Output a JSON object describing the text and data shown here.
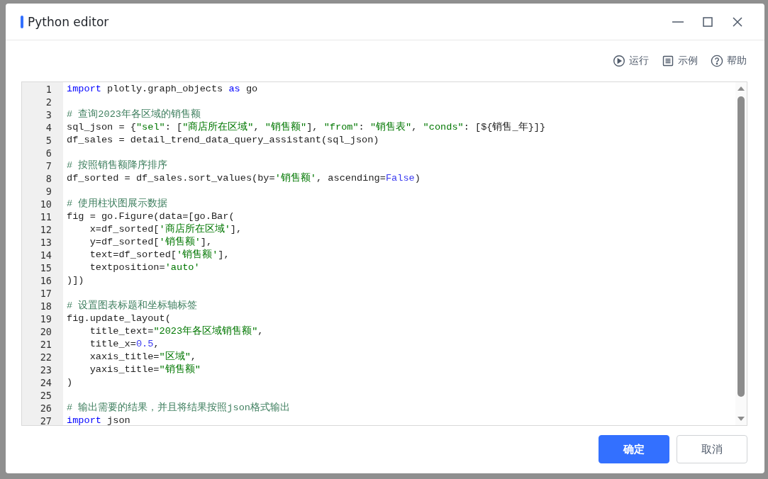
{
  "window": {
    "title": "Python editor"
  },
  "toolbar": [
    {
      "kind": "run",
      "label": "运行"
    },
    {
      "kind": "example",
      "label": "示例"
    },
    {
      "kind": "help",
      "label": "帮助"
    }
  ],
  "editor": {
    "lines": [
      {
        "number": "1",
        "tokens": [
          {
            "kind": "keyword",
            "text": "import"
          },
          {
            "kind": "plain",
            "text": " plotly.graph_objects "
          },
          {
            "kind": "keyword",
            "text": "as"
          },
          {
            "kind": "plain",
            "text": " go"
          }
        ]
      },
      {
        "number": "2"
      },
      {
        "number": "3",
        "tokens": [
          {
            "kind": "comment",
            "text": "# 查询2023年各区域的销售额"
          }
        ]
      },
      {
        "number": "4",
        "tokens": [
          {
            "kind": "plain",
            "text": "sql_json = {"
          },
          {
            "kind": "string",
            "text": "\"sel\""
          },
          {
            "kind": "plain",
            "text": ": ["
          },
          {
            "kind": "string",
            "text": "\"商店所在区域\""
          },
          {
            "kind": "plain",
            "text": ", "
          },
          {
            "kind": "string",
            "text": "\"销售额\""
          },
          {
            "kind": "plain",
            "text": "], "
          },
          {
            "kind": "string",
            "text": "\"from\""
          },
          {
            "kind": "plain",
            "text": ": "
          },
          {
            "kind": "string",
            "text": "\"销售表\""
          },
          {
            "kind": "plain",
            "text": ", "
          },
          {
            "kind": "string",
            "text": "\"conds\""
          },
          {
            "kind": "plain",
            "text": ": [${销售_年}]}"
          }
        ]
      },
      {
        "number": "5",
        "tokens": [
          {
            "kind": "plain",
            "text": "df_sales = detail_trend_data_query_assistant(sql_json)"
          }
        ]
      },
      {
        "number": "6"
      },
      {
        "number": "7",
        "tokens": [
          {
            "kind": "comment",
            "text": "# 按照销售额降序排序"
          }
        ]
      },
      {
        "number": "8",
        "tokens": [
          {
            "kind": "plain",
            "text": "df_sorted = df_sales.sort_values(by="
          },
          {
            "kind": "string",
            "text": "'销售额'"
          },
          {
            "kind": "plain",
            "text": ", ascending="
          },
          {
            "kind": "number",
            "text": "False"
          },
          {
            "kind": "plain",
            "text": ")"
          }
        ]
      },
      {
        "number": "9"
      },
      {
        "number": "10",
        "tokens": [
          {
            "kind": "comment",
            "text": "# 使用柱状图展示数据"
          }
        ]
      },
      {
        "number": "11",
        "tokens": [
          {
            "kind": "plain",
            "text": "fig = go.Figure(data=[go.Bar("
          }
        ]
      },
      {
        "number": "12",
        "tokens": [
          {
            "kind": "plain",
            "text": "    x=df_sorted["
          },
          {
            "kind": "string",
            "text": "'商店所在区域'"
          },
          {
            "kind": "plain",
            "text": "],"
          }
        ]
      },
      {
        "number": "13",
        "tokens": [
          {
            "kind": "plain",
            "text": "    y=df_sorted["
          },
          {
            "kind": "string",
            "text": "'销售额'"
          },
          {
            "kind": "plain",
            "text": "],"
          }
        ]
      },
      {
        "number": "14",
        "tokens": [
          {
            "kind": "plain",
            "text": "    text=df_sorted["
          },
          {
            "kind": "string",
            "text": "'销售额'"
          },
          {
            "kind": "plain",
            "text": "],"
          }
        ]
      },
      {
        "number": "15",
        "tokens": [
          {
            "kind": "plain",
            "text": "    textposition="
          },
          {
            "kind": "string",
            "text": "'auto'"
          }
        ]
      },
      {
        "number": "16",
        "tokens": [
          {
            "kind": "plain",
            "text": ")])"
          }
        ]
      },
      {
        "number": "17"
      },
      {
        "number": "18",
        "tokens": [
          {
            "kind": "comment",
            "text": "# 设置图表标题和坐标轴标签"
          }
        ]
      },
      {
        "number": "19",
        "tokens": [
          {
            "kind": "plain",
            "text": "fig.update_layout("
          }
        ]
      },
      {
        "number": "20",
        "tokens": [
          {
            "kind": "plain",
            "text": "    title_text="
          },
          {
            "kind": "string",
            "text": "\"2023年各区域销售额\""
          },
          {
            "kind": "plain",
            "text": ","
          }
        ]
      },
      {
        "number": "21",
        "tokens": [
          {
            "kind": "plain",
            "text": "    title_x="
          },
          {
            "kind": "number",
            "text": "0.5"
          },
          {
            "kind": "plain",
            "text": ","
          }
        ]
      },
      {
        "number": "22",
        "tokens": [
          {
            "kind": "plain",
            "text": "    xaxis_title="
          },
          {
            "kind": "string",
            "text": "\"区域\""
          },
          {
            "kind": "plain",
            "text": ","
          }
        ]
      },
      {
        "number": "23",
        "tokens": [
          {
            "kind": "plain",
            "text": "    yaxis_title="
          },
          {
            "kind": "string",
            "text": "\"销售额\""
          }
        ]
      },
      {
        "number": "24",
        "tokens": [
          {
            "kind": "plain",
            "text": ")"
          }
        ]
      },
      {
        "number": "25"
      },
      {
        "number": "26",
        "tokens": [
          {
            "kind": "comment",
            "text": "# 输出需要的结果，并且将结果按照json格式输出"
          }
        ]
      },
      {
        "number": "27",
        "tokens": [
          {
            "kind": "keyword",
            "text": "import"
          },
          {
            "kind": "plain",
            "text": " json"
          }
        ]
      }
    ]
  },
  "buttons": [
    {
      "kind": "primary",
      "label": "确定"
    },
    {
      "kind": "secondary",
      "label": "取消"
    }
  ]
}
